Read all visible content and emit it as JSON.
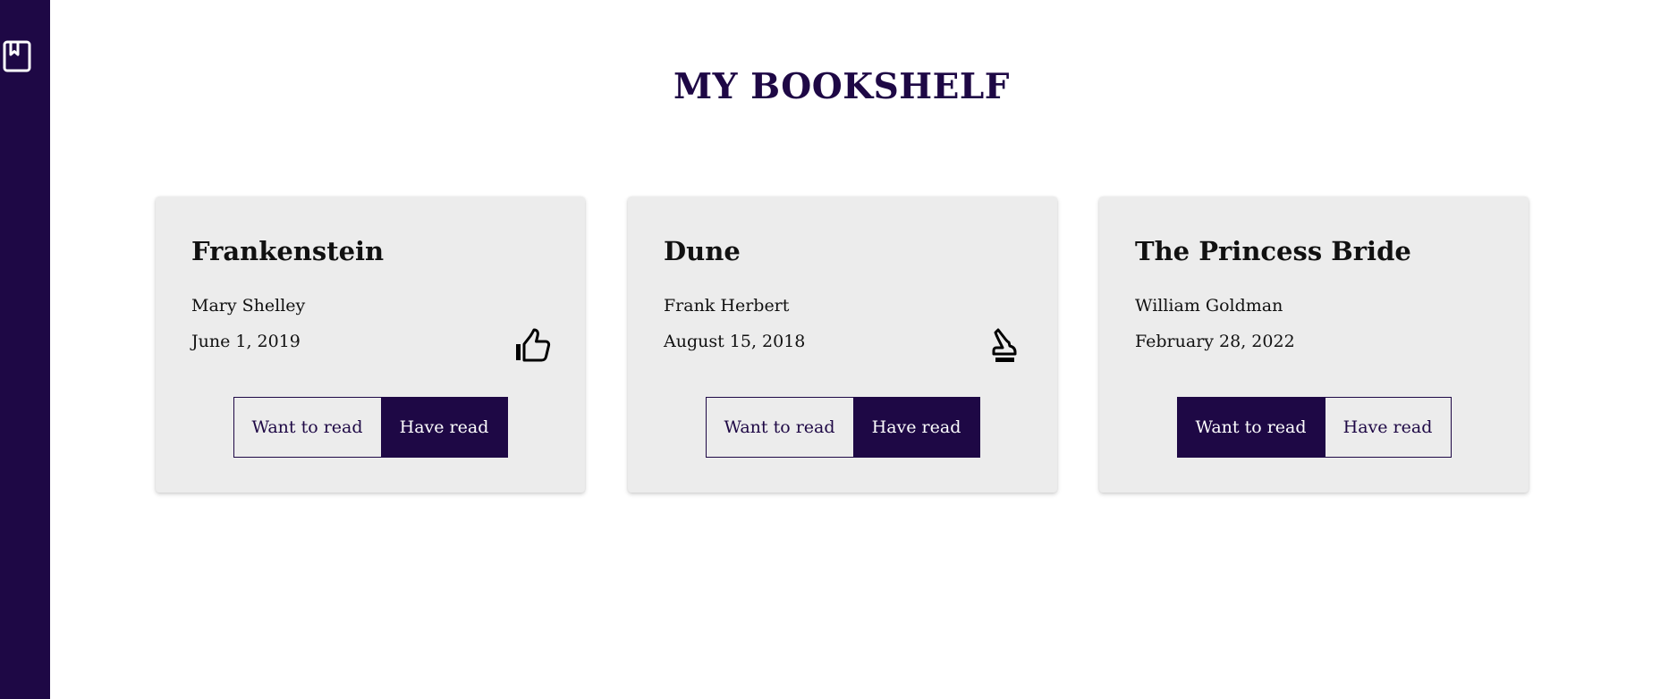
{
  "app": {
    "title": "MY BOOKSHELF",
    "brand_color": "#1e0845",
    "sidebar_icon": "bookmark-icon"
  },
  "books": [
    {
      "title": "Frankenstein",
      "author": "Mary Shelley",
      "date": "June 1, 2019",
      "status_icon": "thumbs-up-icon",
      "want_label": "Want to read",
      "have_label": "Have read",
      "selected": "have"
    },
    {
      "title": "Dune",
      "author": "Frank Herbert",
      "date": "August 15, 2018",
      "status_icon": "thumbs-down-icon",
      "want_label": "Want to read",
      "have_label": "Have read",
      "selected": "have"
    },
    {
      "title": "The Princess Bride",
      "author": "William Goldman",
      "date": "February 28, 2022",
      "status_icon": "",
      "want_label": "Want to read",
      "have_label": "Have read",
      "selected": "want"
    }
  ]
}
